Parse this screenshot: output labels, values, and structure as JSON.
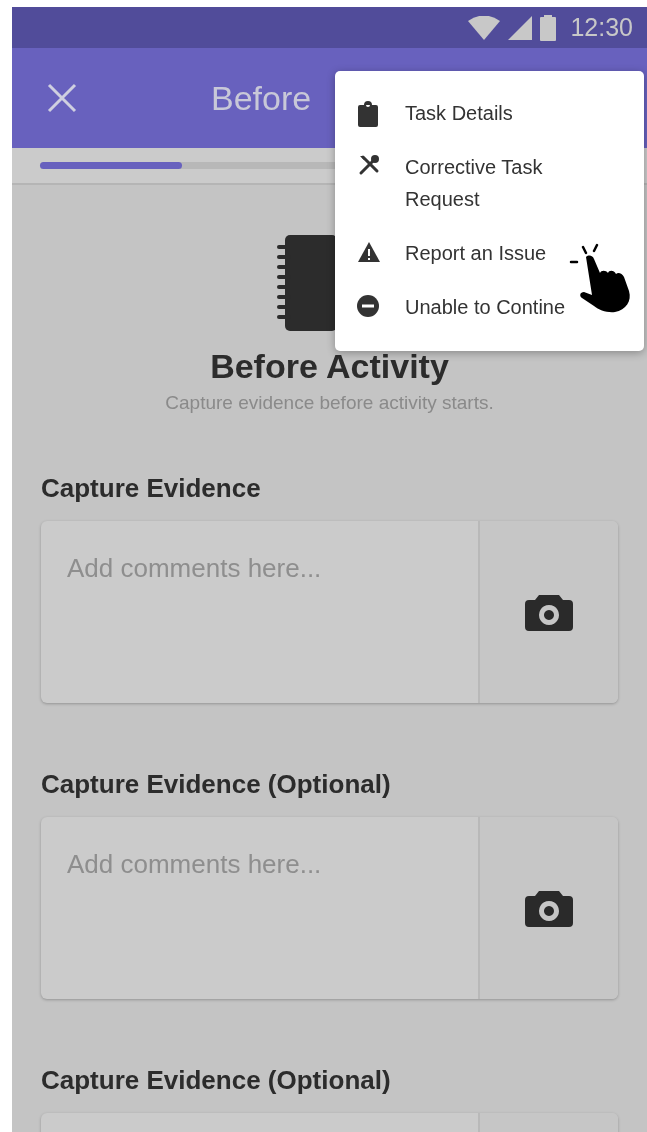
{
  "status_bar": {
    "time": "12:30"
  },
  "app_bar": {
    "title": "Before"
  },
  "progress": {
    "level": 0.25
  },
  "header": {
    "title": "Before Activity",
    "subtitle": "Capture evidence before activity starts."
  },
  "sections": [
    {
      "label": "Capture Evidence",
      "placeholder": "Add comments here..."
    },
    {
      "label": "Capture Evidence (Optional)",
      "placeholder": "Add comments here..."
    },
    {
      "label": "Capture Evidence (Optional)"
    }
  ],
  "menu": {
    "items": [
      {
        "kind": "clipboard",
        "label": "Task Details"
      },
      {
        "kind": "tools",
        "label": "Corrective Task Request"
      },
      {
        "kind": "warning",
        "label": "Report an Issue"
      },
      {
        "kind": "minus",
        "label": "Unable to Contine"
      }
    ]
  }
}
